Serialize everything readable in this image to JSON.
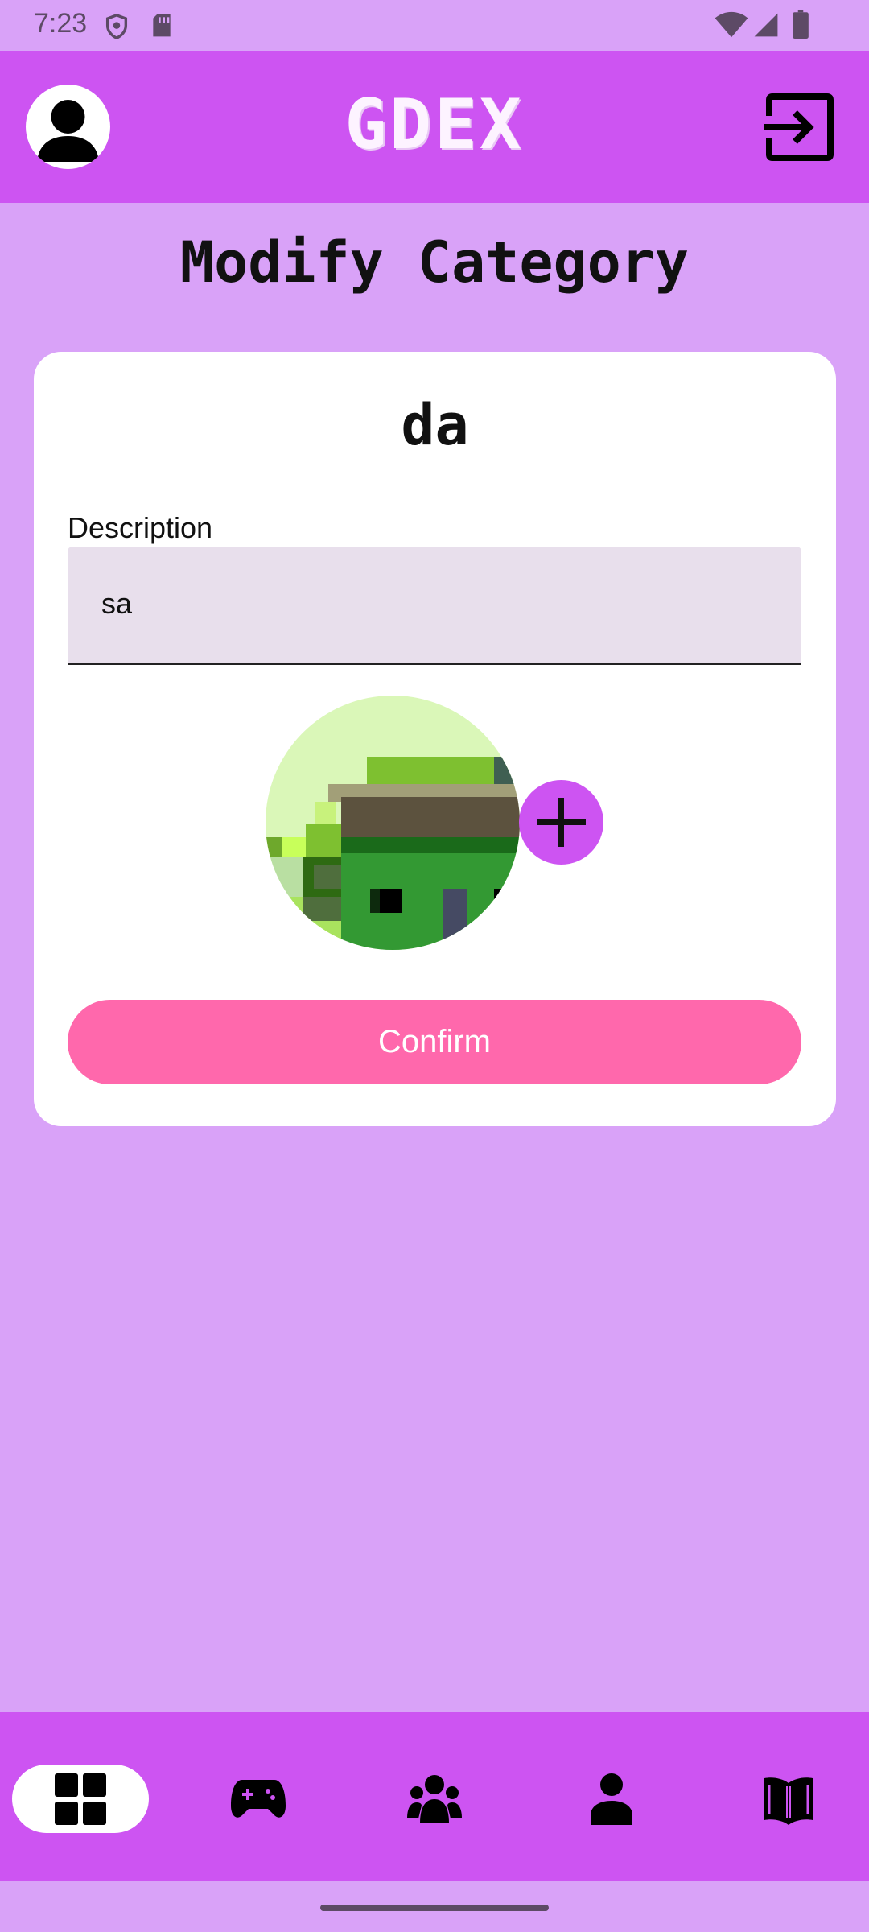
{
  "status_bar": {
    "time": "7:23",
    "icons": [
      "shield-icon",
      "sd-card-icon",
      "wifi-icon",
      "signal-icon",
      "battery-icon"
    ]
  },
  "app_bar": {
    "title": "GDEX",
    "avatar_icon": "account-icon",
    "logout_icon": "logout-icon"
  },
  "page": {
    "title": "Modify Category"
  },
  "form": {
    "category_name": "da",
    "description_label": "Description",
    "description_value": "sa",
    "image_icon": "category-pixel-art-image",
    "add_image_icon": "plus-icon",
    "confirm_label": "Confirm"
  },
  "bottom_nav": {
    "items": [
      {
        "icon": "dashboard-icon",
        "active": true
      },
      {
        "icon": "gamepad-icon",
        "active": false
      },
      {
        "icon": "group-icon",
        "active": false
      },
      {
        "icon": "person-icon",
        "active": false
      },
      {
        "icon": "book-icon",
        "active": false
      }
    ]
  },
  "colors": {
    "background": "#d9a2f8",
    "app_bar": "#cd54f2",
    "confirm": "#ff68ac",
    "field": "#e8dfec"
  }
}
